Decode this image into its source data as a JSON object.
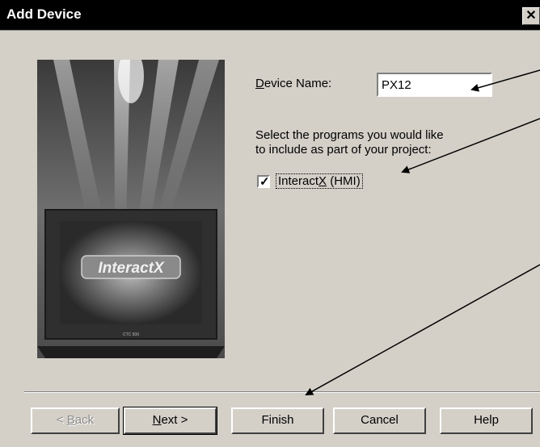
{
  "window": {
    "title": "Add Device",
    "close_glyph": "✕"
  },
  "form": {
    "device_name_label_prefix": "D",
    "device_name_label_rest": "evice Name:",
    "device_name_value": "PX12",
    "programs_prompt_line1": "Select the programs you would like",
    "programs_prompt_line2": "to include as part of your project:",
    "checkbox_label_prefix": "Interact",
    "checkbox_label_accel": "X",
    "checkbox_label_suffix": " (HMI)",
    "checkbox_checked": true
  },
  "image": {
    "logo_text": "InteractX",
    "bezel_text": "CTC 500"
  },
  "buttons": {
    "back_prefix": "< ",
    "back_accel": "B",
    "back_rest": "ack",
    "next_accel": "N",
    "next_rest": "ext >",
    "finish": "Finish",
    "cancel": "Cancel",
    "help": "Help"
  },
  "colors": {
    "title_bg": "#000000",
    "dialog_bg": "#d4d0c8"
  },
  "icons": [
    "close-icon",
    "checkmark-icon",
    "annotation-arrow-icon"
  ]
}
